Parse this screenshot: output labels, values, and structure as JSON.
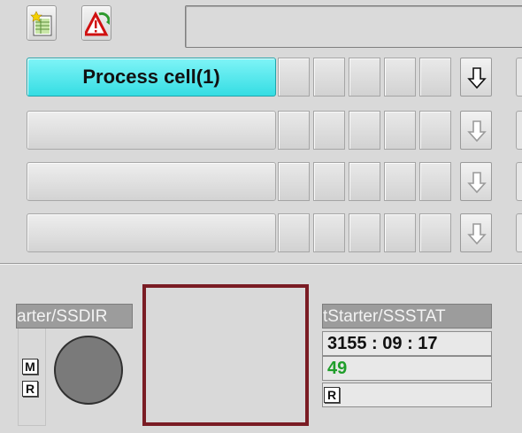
{
  "toolbar": {
    "buttons": [
      {
        "name": "new-list-icon"
      },
      {
        "name": "alarm-refresh-icon"
      }
    ],
    "message_text": ""
  },
  "process_cells": [
    {
      "label": "Process cell(1)",
      "active": true,
      "arrow_enabled": true
    },
    {
      "label": "",
      "active": false,
      "arrow_enabled": false
    },
    {
      "label": "",
      "active": false,
      "arrow_enabled": false
    },
    {
      "label": "",
      "active": false,
      "arrow_enabled": false
    }
  ],
  "faceplate_dir": {
    "tag": "arter/SSDIR",
    "mode_m": "M",
    "mode_r": "R"
  },
  "faceplate_stat": {
    "tag": "tStarter/SSSTAT",
    "runtime": "3155 : 09 : 17",
    "value": "49",
    "mode_r": "R"
  },
  "colors": {
    "active_cell": "#35dde3",
    "frame_red": "#7a1c24",
    "value_green": "#1f9e2a"
  }
}
